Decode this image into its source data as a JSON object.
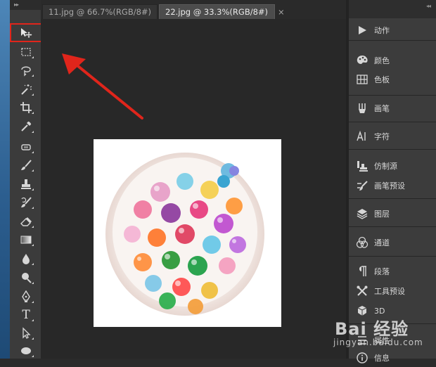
{
  "tabs": [
    {
      "label": "11.jpg @ 66.7%(RGB/8#)",
      "close": "×",
      "active": false
    },
    {
      "label": "22.jpg @ 33.3%(RGB/8#)",
      "close": "×",
      "active": true
    }
  ],
  "toolbox": {
    "grip": "▸▸",
    "tools": [
      "move-tool",
      "rect-marquee-tool",
      "lasso-tool",
      "magic-wand-tool",
      "crop-tool",
      "eyedropper-tool",
      "spot-healing-tool",
      "brush-tool",
      "clone-stamp-tool",
      "history-brush-tool",
      "eraser-tool",
      "gradient-tool",
      "blur-tool",
      "dodge-tool",
      "pen-tool",
      "type-tool",
      "path-selection-tool",
      "ellipse-tool"
    ],
    "type_glyph": "T"
  },
  "panel": {
    "grip": "◂◂",
    "items": [
      {
        "label": "动作",
        "icon": "play-icon"
      },
      {
        "label": "颜色",
        "icon": "palette-icon"
      },
      {
        "label": "色板",
        "icon": "swatches-icon"
      },
      {
        "label": "画笔",
        "icon": "brush-icon"
      },
      {
        "label": "字符",
        "icon": "character-icon"
      },
      {
        "label": "仿制源",
        "icon": "clone-source-icon"
      },
      {
        "label": "画笔预设",
        "icon": "brush-presets-icon"
      },
      {
        "label": "图层",
        "icon": "layers-icon"
      },
      {
        "label": "通道",
        "icon": "channels-icon"
      },
      {
        "label": "段落",
        "icon": "paragraph-icon"
      },
      {
        "label": "工具预设",
        "icon": "tool-presets-icon"
      },
      {
        "label": "3D",
        "icon": "3d-icon"
      },
      {
        "label": "属性",
        "icon": "properties-icon"
      },
      {
        "label": "信息",
        "icon": "info-icon"
      }
    ]
  },
  "watermark": {
    "logo": "Bai 经验",
    "url": "jingyan.baidu.com"
  },
  "colors": {
    "highlight": "#e0251b",
    "arrow": "#e0251b",
    "ui_dark": "#2b2b2b",
    "panel": "#3c3c3c"
  }
}
